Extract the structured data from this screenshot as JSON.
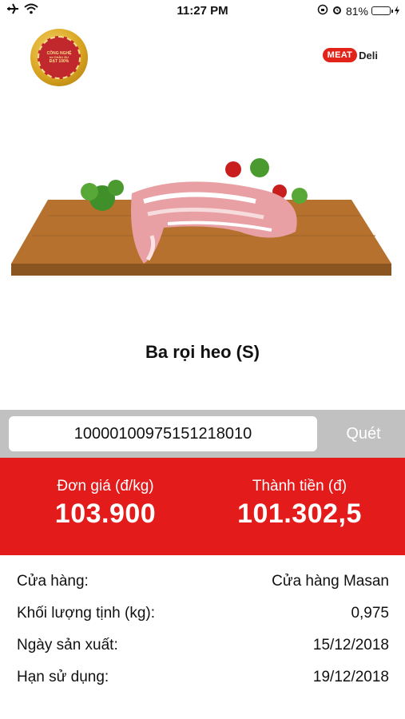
{
  "status_bar": {
    "time": "11:27 PM",
    "battery_percent": "81%",
    "battery_level": 0.81
  },
  "badge": {
    "text_top": "CÔNG NGHỆ",
    "text_mid": "từ CHÂU ÂU",
    "text_bottom": "ĐẠT 100%"
  },
  "logo": {
    "meat": "MEAT",
    "deli": "Deli"
  },
  "product": {
    "name": "Ba rọi heo (S)"
  },
  "scan": {
    "barcode": "1000010097515121801​0",
    "button_label": "Quét"
  },
  "price": {
    "unit_label": "Đơn giá (đ/kg)",
    "unit_value": "103.900",
    "total_label": "Thành tiền (đ)",
    "total_value": "101.302,5"
  },
  "details": [
    {
      "label": "Cửa hàng:",
      "value": "Cửa hàng Masan"
    },
    {
      "label": "Khối lượng tịnh (kg):",
      "value": "0,975"
    },
    {
      "label": "Ngày sản xuất:",
      "value": "15/12/2018"
    },
    {
      "label": "Hạn sử dụng:",
      "value": "19/12/2018"
    }
  ],
  "colors": {
    "accent": "#e31b1b",
    "scan_bar": "#c1c1c1"
  }
}
